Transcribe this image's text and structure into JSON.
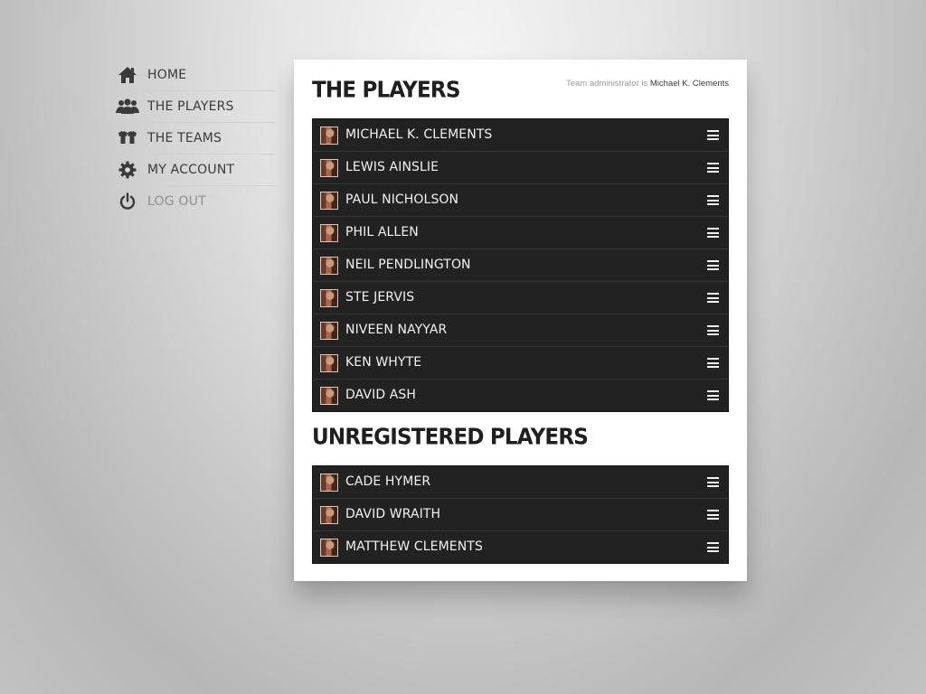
{
  "sidebar": {
    "items": [
      {
        "label": "Home",
        "icon": "home-icon"
      },
      {
        "label": "The Players",
        "icon": "users-icon"
      },
      {
        "label": "The Teams",
        "icon": "shirts-icon"
      },
      {
        "label": "My Account",
        "icon": "gear-icon"
      },
      {
        "label": "Log Out",
        "icon": "power-icon"
      }
    ]
  },
  "main": {
    "title": "The Players",
    "admin_prefix": "Team administrator is ",
    "admin_name": "Michael K. Clements",
    "players": [
      "Michael K. Clements",
      "Lewis Ainslie",
      "Paul Nicholson",
      "Phil Allen",
      "Neil Pendlington",
      "Ste Jervis",
      "Niveen Nayyar",
      "Ken Whyte",
      "David Ash"
    ],
    "unregistered_title": "Unregistered Players",
    "unregistered": [
      "Cade Hymer",
      "David Wraith",
      "Matthew Clements"
    ]
  },
  "colors": {
    "list_background": "#222222",
    "text_dark": "#1f1f1f",
    "nav_text": "#3a3a3a",
    "nav_muted": "#8f8f8f"
  }
}
